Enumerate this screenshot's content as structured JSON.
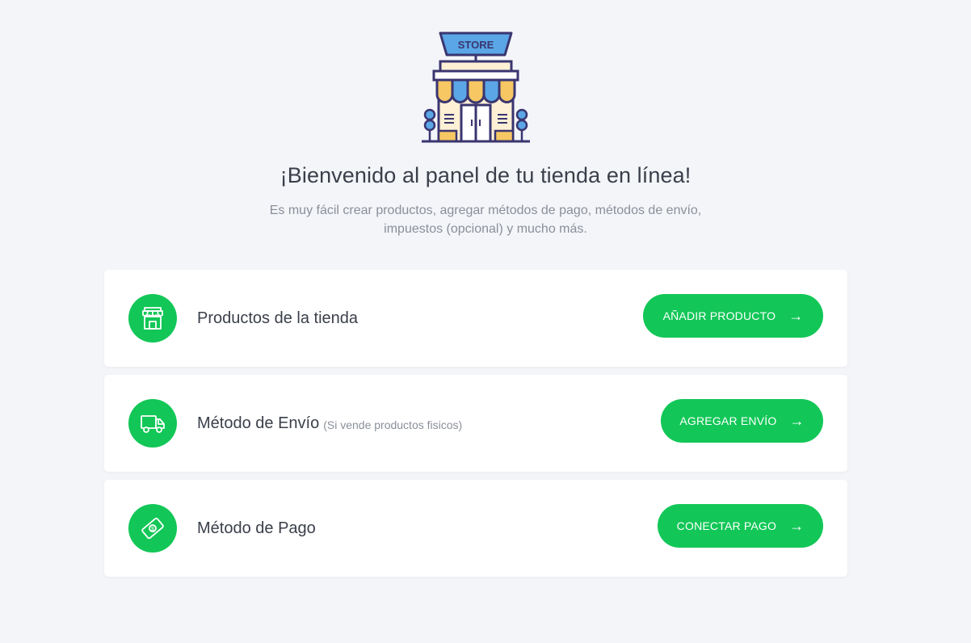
{
  "header": {
    "illustration_label": "STORE",
    "title": "¡Bienvenido al panel de tu tienda en línea!",
    "subtitle_line1": "Es muy fácil crear productos, agregar métodos de pago, métodos de envío,",
    "subtitle_line2": "impuestos (opcional) y mucho más."
  },
  "cards": [
    {
      "icon": "store-icon",
      "label": "Productos de la tienda",
      "note": "",
      "button": "AÑADIR PRODUCTO",
      "arrow": "→"
    },
    {
      "icon": "truck-icon",
      "label": "Método de Envío",
      "note": "(Si vende productos fisicos)",
      "button": "AGREGAR ENVÍO",
      "arrow": "→"
    },
    {
      "icon": "money-icon",
      "label": "Método de Pago",
      "note": "",
      "button": "CONECTAR PAGO",
      "arrow": "→"
    }
  ],
  "colors": {
    "accent": "#12c757",
    "background": "#f4f5f9",
    "card": "#ffffff",
    "text": "#3a3f4a",
    "muted": "#8a8f99"
  }
}
